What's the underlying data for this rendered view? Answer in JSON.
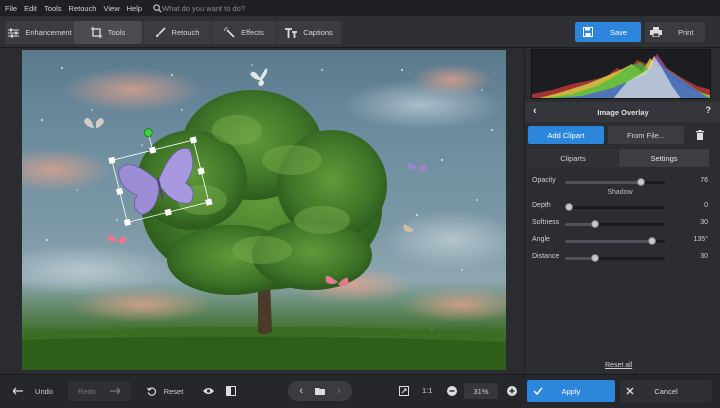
{
  "menu": [
    "File",
    "Edit",
    "Tools",
    "Retouch",
    "View",
    "Help"
  ],
  "search": {
    "placeholder": "What do you want to do?"
  },
  "tabs": [
    {
      "label": "Enhancement",
      "icon": "sliders-icon"
    },
    {
      "label": "Tools",
      "icon": "crop-icon"
    },
    {
      "label": "Retouch",
      "icon": "brush-icon"
    },
    {
      "label": "Effects",
      "icon": "wand-icon"
    },
    {
      "label": "Captions",
      "icon": "text-icon"
    }
  ],
  "toolbar": {
    "save_label": "Save",
    "print_label": "Print"
  },
  "panel": {
    "title": "Image Overlay",
    "help": "?",
    "add_clipart": "Add Clipart",
    "from_file": "From File...",
    "subtabs": [
      "Cliparts",
      "Settings"
    ],
    "shadow_label": "Shadow",
    "reset_all": "Reset all",
    "sliders": [
      {
        "label": "Opacity",
        "value": "76",
        "fraction": 0.76
      },
      {
        "label": "Depth",
        "value": "0",
        "fraction": 0.0
      },
      {
        "label": "Softness",
        "value": "30",
        "fraction": 0.3
      },
      {
        "label": "Angle",
        "value": "135°",
        "fraction": 0.87
      },
      {
        "label": "Distance",
        "value": "30",
        "fraction": 0.3
      }
    ]
  },
  "bottom": {
    "undo": "Undo",
    "redo": "Redo",
    "reset": "Reset",
    "zoom_ratio": "1:1",
    "zoom_value": "31%",
    "apply": "Apply",
    "cancel": "Cancel"
  },
  "colors": {
    "accent": "#2b86dc",
    "bg": "#2b2d31"
  }
}
